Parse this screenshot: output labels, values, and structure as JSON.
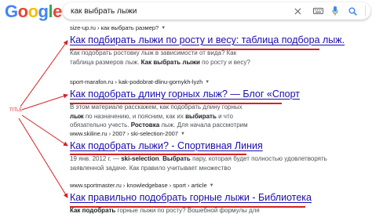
{
  "logo": "Google",
  "search": {
    "query": "как выбрать лыжи"
  },
  "annotation": "TITLE",
  "colors": {
    "accent_red": "#d62020",
    "link": "#1a0dab"
  },
  "results": [
    {
      "url": "size-up.ru › как выбрать размер?",
      "title": "Как подбирать лыжи по росту и весу: таблица подбора лыж.",
      "snippet": [
        "Как подобрать ростовку лыж в зависимости от вида? Как",
        "",
        " таблица размеров лыж.",
        "Как выбрать лыжи",
        " по росту и весу?"
      ]
    },
    {
      "url": "sport-marafon.ru › kak-podobrat-dlinu-gornykh-lyzh",
      "title": "Как подобрать длину горных лыж? — Блог «Спорт",
      "snippet": [
        "В этом материале расскажем, как подобрать длину горных",
        "лыж",
        " по назначению, и поясним, как их ",
        "выбирать",
        " и что",
        "обязательно учесть.",
        "Ростовка",
        " лыж. Для начала рассмотрим"
      ]
    },
    {
      "url": "www.skiline.ru › 2007 › ski-selection-2007",
      "title": "Как подобрать лыжи? - Спортивная Линия",
      "snippet": [
        "19 янв. 2012 г. — ",
        "ski-selection",
        ". ",
        "Выбрать",
        " пару, которая будет полностью удовлетворять",
        "заявленной задаче. Как правило учитывает множество"
      ]
    },
    {
      "url": "www.sportmaster.ru › knowledgebase › sport › article",
      "title": "Как правильно подобрать горные лыжи - Библиотека",
      "snippet": [
        "Как подобрать",
        " горные лыжи по росту? Вошебной формулы для"
      ]
    }
  ]
}
